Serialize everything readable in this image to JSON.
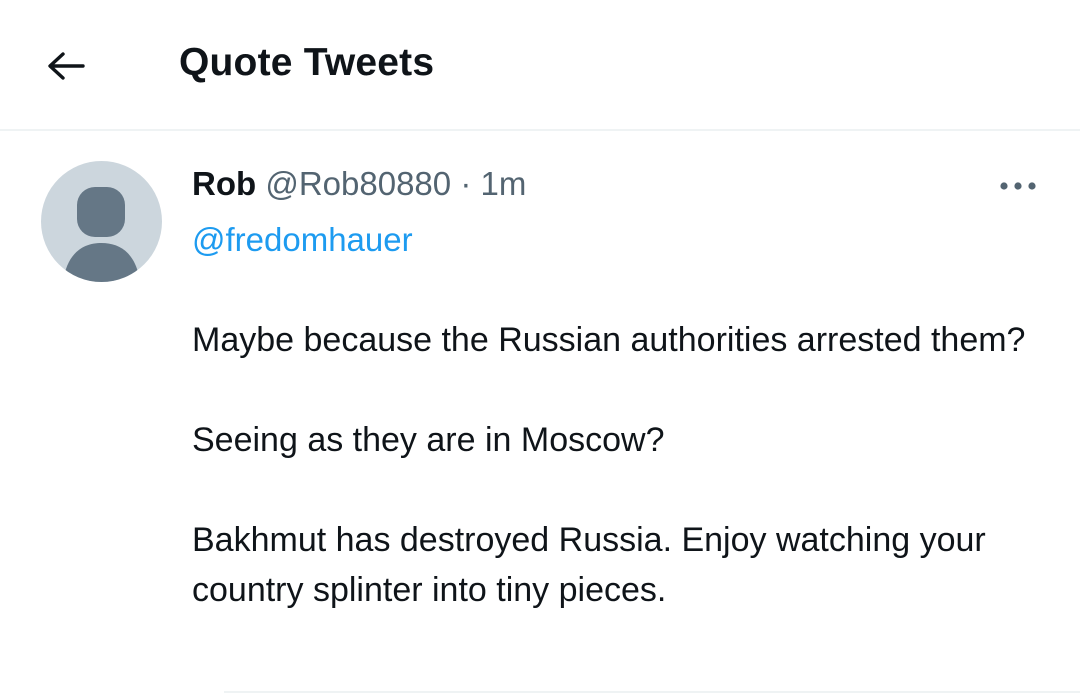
{
  "header": {
    "back_icon": "arrow-left-icon",
    "title": "Quote Tweets"
  },
  "tweet": {
    "author_name": "Rob",
    "author_handle": "@Rob80880",
    "separator": "·",
    "timestamp": "1m",
    "more_icon": "more-horizontal-icon",
    "reply_to": "@fredomhauer",
    "paragraphs": [
      "Maybe because the Russian authorities arrested them?",
      "Seeing as they are in Moscow?",
      "Bakhmut has destroyed Russia. Enjoy watching your country splinter into tiny pieces."
    ]
  },
  "colors": {
    "text_primary": "#0f1419",
    "text_secondary": "#536471",
    "link": "#1d9bf0",
    "avatar_bg": "#ccd6dd",
    "avatar_fg": "#657786",
    "divider": "#eff3f4"
  }
}
